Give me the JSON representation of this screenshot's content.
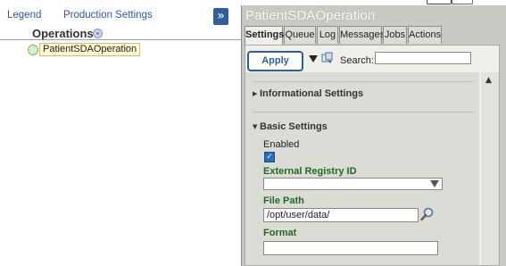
{
  "nav": {
    "legend": "Legend",
    "production_settings": "Production Settings",
    "collapse_glyph": "»"
  },
  "operations": {
    "title": "Operations",
    "plus_glyph": "+",
    "items": [
      {
        "label": "PatientSDAOperation",
        "status_color": "#d8f0c8"
      }
    ]
  },
  "details": {
    "title": "PatientSDAOperation",
    "tabs": [
      "Settings",
      "Queue",
      "Log",
      "Messages",
      "Jobs",
      "Actions"
    ],
    "active_tab": "Settings",
    "apply_label": "Apply",
    "search_label": "Search:",
    "search_value": "",
    "sections": {
      "informational": "Informational Settings",
      "basic": "Basic Settings"
    },
    "fields": {
      "enabled_label": "Enabled",
      "enabled_checked": true,
      "external_registry_label": "External Registry ID",
      "external_registry_value": "",
      "file_path_label": "File Path",
      "file_path_value": "/opt/user/data/",
      "format_label": "Format",
      "format_value": ""
    }
  },
  "colors": {
    "accent": "#2f5f9a",
    "link": "#2a5aa8",
    "field_label_green": "#1e6b1e",
    "panel_bg": "#c9c9c4"
  }
}
